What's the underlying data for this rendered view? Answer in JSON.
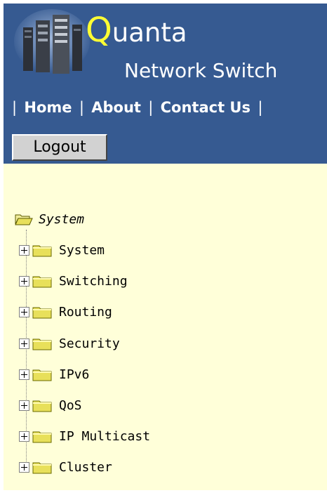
{
  "header": {
    "brand_first_letter": "Q",
    "brand_rest": "uanta",
    "subtitle": "Network Switch",
    "separator": "|",
    "nav": [
      {
        "label": "Home"
      },
      {
        "label": "About"
      },
      {
        "label": "Contact Us"
      }
    ],
    "logout_label": "Logout"
  },
  "tree": {
    "root_label": "System",
    "items": [
      {
        "label": "System"
      },
      {
        "label": "Switching"
      },
      {
        "label": "Routing"
      },
      {
        "label": "Security"
      },
      {
        "label": "IPv6"
      },
      {
        "label": "QoS"
      },
      {
        "label": "IP Multicast"
      },
      {
        "label": "Cluster"
      }
    ]
  },
  "colors": {
    "banner": "#365a91",
    "tree_background": "#ffffd9",
    "brand_accent": "#ffff33",
    "folder": "#e8e05a"
  },
  "icons": {
    "server": "server-rack-icon",
    "folder_open": "folder-open-icon",
    "folder": "folder-icon",
    "expand": "plus-box-icon"
  }
}
